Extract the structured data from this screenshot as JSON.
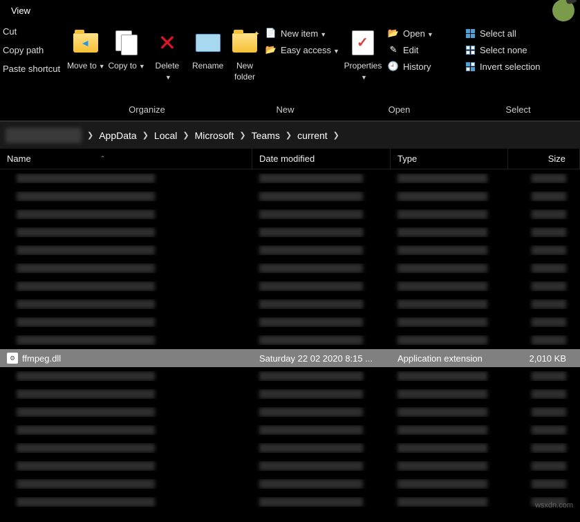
{
  "menubar": {
    "view": "View"
  },
  "ribbon": {
    "clipboard": {
      "cut": "Cut",
      "copy_path": "Copy path",
      "paste_shortcut": "Paste shortcut"
    },
    "organize": {
      "label": "Organize",
      "move_to": "Move to",
      "copy_to": "Copy to",
      "delete": "Delete",
      "rename": "Rename"
    },
    "new": {
      "label": "New",
      "new_folder": "New folder",
      "new_item": "New item",
      "easy_access": "Easy access"
    },
    "open": {
      "label": "Open",
      "properties": "Properties",
      "open": "Open",
      "edit": "Edit",
      "history": "History"
    },
    "select": {
      "label": "Select",
      "select_all": "Select all",
      "select_none": "Select none",
      "invert_selection": "Invert selection"
    }
  },
  "breadcrumb": {
    "items": [
      "AppData",
      "Local",
      "Microsoft",
      "Teams",
      "current"
    ]
  },
  "columns": {
    "name": "Name",
    "date": "Date modified",
    "type": "Type",
    "size": "Size"
  },
  "selected_file": {
    "name": "ffmpeg.dll",
    "date": "Saturday 22 02 2020 8:15 ...",
    "type": "Application extension",
    "size": "2,010 KB"
  },
  "blur_rows_before": 10,
  "blur_rows_after": 8,
  "watermark": "wsxdn.com"
}
